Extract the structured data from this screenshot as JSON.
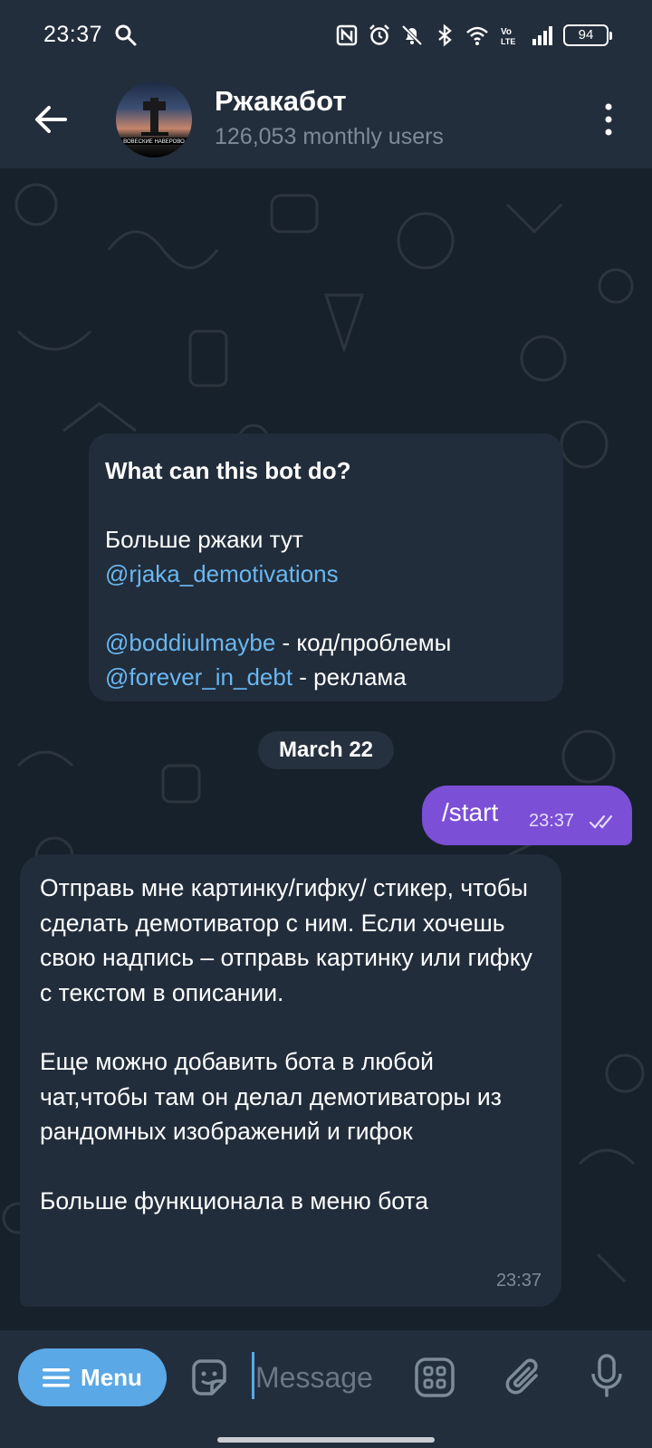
{
  "status_bar": {
    "time": "23:37",
    "battery": "94",
    "icons": [
      "search-icon",
      "nfc-icon",
      "alarm-icon",
      "mute-icon",
      "bluetooth-icon",
      "wifi-icon",
      "volte-icon",
      "signal-icon",
      "battery-icon"
    ]
  },
  "header": {
    "title": "Ржакабот",
    "subtitle": "126,053 monthly users",
    "avatar_caption": "ВОВЕСКИЕ НАВЕРОВО"
  },
  "info_card": {
    "question": "What can this bot do?",
    "line1": "Больше ржаки тут",
    "link1": "@rjaka_demotivations",
    "link2": "@boddiulmaybe",
    "text2": " - код/проблемы",
    "link3": "@forever_in_debt",
    "text3": " - реклама"
  },
  "date_separator": "March 22",
  "outgoing_message": {
    "text": "/start",
    "time": "23:37"
  },
  "incoming_message": {
    "paragraph1": "Отправь мне картинку/гифку/ стикер, чтобы сделать демотиватор с ним. Если хочешь свою надпись – отправь картинку или гифку с текстом в описании.",
    "paragraph2": "Еще можно добавить бота в любой чат,чтобы там он делал демотиваторы из рандомных изображений и гифок",
    "paragraph3": "Больше функционала в меню бота",
    "time": "23:37"
  },
  "composer": {
    "menu_label": "Menu",
    "placeholder": "Message"
  },
  "colors": {
    "accent": "#5aa8e6",
    "outgoing_bubble": "#7b4fd6",
    "incoming_bubble": "#212d3b",
    "link": "#6ab7f0",
    "header_bg": "#232e3c",
    "chat_bg": "#17212b"
  }
}
